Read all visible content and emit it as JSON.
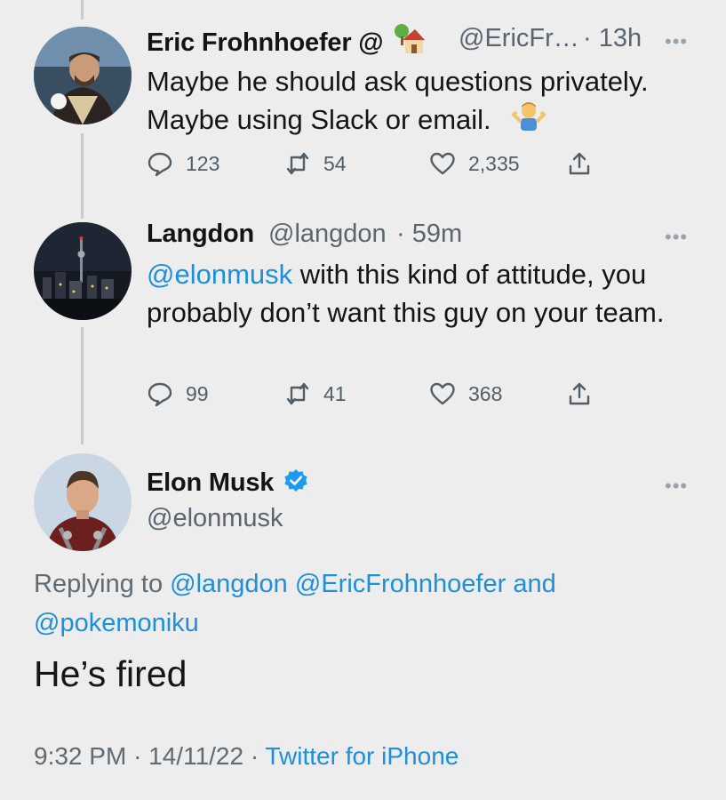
{
  "tweets": [
    {
      "display_name": "Eric Frohnhoefer @",
      "name_emoji": "house-with-tree-emoji",
      "handle": "@EricFr…",
      "time": "· 13h",
      "text_lines": [
        "Maybe he should ask questions privately.",
        "Maybe using Slack or email."
      ],
      "text_emoji": "person-shrugging-emoji",
      "replies": "123",
      "retweets": "54",
      "likes": "2,335",
      "more": "•••"
    },
    {
      "display_name": "Langdon",
      "handle": "@langdon",
      "time": "· 59m",
      "mention": "@elonmusk",
      "text_rest": " with this kind of attitude, you probably don’t want this guy on your team.",
      "replies": "99",
      "retweets": "41",
      "likes": "368",
      "more": "•••"
    }
  ],
  "main_tweet": {
    "display_name": "Elon Musk",
    "verified_icon": "verified-badge-icon",
    "handle": "@elonmusk",
    "more": "•••",
    "replying_prefix": "Replying to",
    "replying_to": [
      "@langdon",
      "@EricFrohnhoefer"
    ],
    "replying_and": "and",
    "replying_last": "@pokemoniku",
    "text": "He’s fired",
    "time": "9:32 PM",
    "date": "· 14/11/22 ·",
    "source": "Twitter for iPhone"
  },
  "colors": {
    "background": "#ededed",
    "link": "#1d8fdc",
    "secondary_text": "#5b6570",
    "verified": "#1d9bf0"
  }
}
